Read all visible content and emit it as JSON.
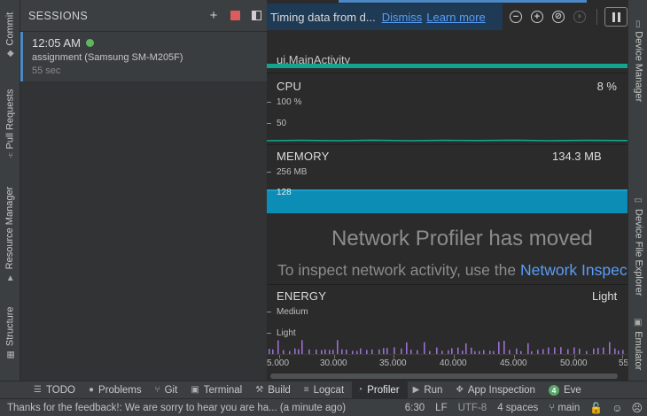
{
  "left_tabs": [
    {
      "label": "Commit",
      "icon": "commit-icon",
      "glyph": "◆"
    },
    {
      "label": "Pull Requests",
      "icon": "pull-request-icon",
      "glyph": "⑂"
    },
    {
      "label": "Resource Manager",
      "icon": "resource-manager-icon",
      "glyph": "▲"
    },
    {
      "label": "Structure",
      "icon": "structure-icon",
      "glyph": "▦"
    }
  ],
  "right_tabs": [
    {
      "label": "Device Manager",
      "icon": "device-manager-icon",
      "glyph": "▯"
    },
    {
      "label": "Device File Explorer",
      "icon": "device-file-explorer-icon",
      "glyph": "▭"
    },
    {
      "label": "Emulator",
      "icon": "emulator-icon",
      "glyph": "▣"
    }
  ],
  "sessions": {
    "title": "SESSIONS",
    "add_glyph": "+",
    "items": [
      {
        "time": "12:05 AM",
        "device": "assignment (Samsung SM-M205F)",
        "duration": "55 sec"
      }
    ]
  },
  "notice": {
    "text": "Timing data from d...",
    "dismiss": "Dismiss",
    "learn_more": "Learn more"
  },
  "toolbar": {
    "zoom_out_glyph": "−",
    "zoom_in_glyph": "+",
    "reset_glyph": "⊘",
    "live_glyph": "⏵"
  },
  "profiler": {
    "activity": "ui.MainActivity",
    "cpu": {
      "title": "CPU",
      "value": "8 %",
      "axis": [
        "100 %",
        "50"
      ]
    },
    "memory": {
      "title": "MEMORY",
      "value": "134.3 MB",
      "axis": [
        "256 MB",
        "128"
      ]
    },
    "network": {
      "title": "Network Profiler has moved",
      "subtitle_prefix": "To inspect network activity, use the ",
      "subtitle_link": "Network Inspector"
    },
    "energy": {
      "title": "ENERGY",
      "value": "Light",
      "axis": [
        "Medium",
        "Light"
      ]
    },
    "time_axis": [
      "5.000",
      "30.000",
      "35.000",
      "40.000",
      "45.000",
      "50.000",
      "55"
    ]
  },
  "bottom_tabs": [
    {
      "label": "TODO",
      "icon": "todo-list-icon",
      "glyph": "☰"
    },
    {
      "label": "Problems",
      "icon": "problems-icon",
      "glyph": "●"
    },
    {
      "label": "Git",
      "icon": "git-branch-icon",
      "glyph": "⑂"
    },
    {
      "label": "Terminal",
      "icon": "terminal-icon",
      "glyph": "▣"
    },
    {
      "label": "Build",
      "icon": "build-hammer-icon",
      "glyph": "⚒"
    },
    {
      "label": "Logcat",
      "icon": "logcat-icon",
      "glyph": "≡"
    },
    {
      "label": "Profiler",
      "icon": "profiler-gauge-icon",
      "glyph": "◔"
    },
    {
      "label": "Run",
      "icon": "run-play-icon",
      "glyph": "▶"
    },
    {
      "label": "App Inspection",
      "icon": "app-inspection-icon",
      "glyph": "✥"
    },
    {
      "label": "Eve",
      "icon": "event-log-icon",
      "glyph": "4"
    }
  ],
  "status": {
    "message": "Thanks for the feedback!: We are sorry to hear you are ha... (a minute ago)",
    "position": "6:30",
    "line_sep": "LF",
    "encoding": "UTF-8",
    "indent": "4 spaces",
    "branch": "main"
  },
  "colors": {
    "accent": "#4a88c7",
    "activity_bar": "#12a58d",
    "memory": "#0c8db6",
    "energy": "#9b6ed1",
    "stop": "#db5c5c",
    "link": "#589df6"
  }
}
